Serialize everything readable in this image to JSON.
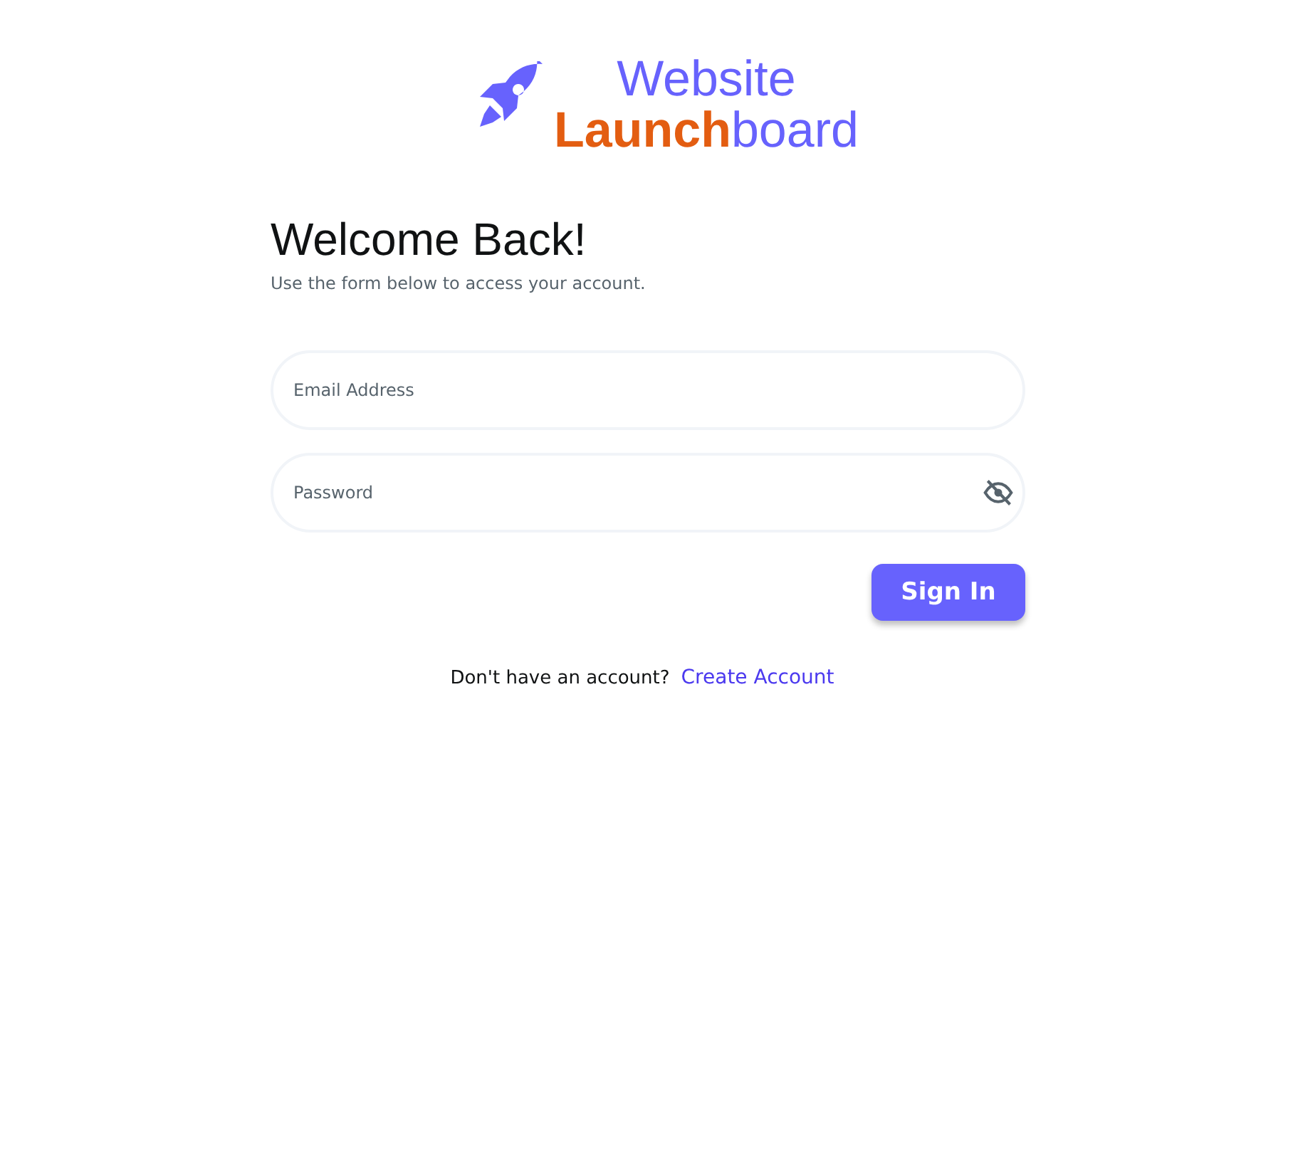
{
  "logo": {
    "line1": "Website",
    "accent": "Launch",
    "rest": "board"
  },
  "title": "Welcome Back!",
  "subtitle": "Use the form below to access your account.",
  "fields": [
    {
      "kind": "text",
      "placeholder": "Email Address"
    },
    {
      "kind": "password",
      "placeholder": "Password"
    }
  ],
  "sign_in": "Sign In",
  "footer": {
    "prompt": "Don't have an account?",
    "link": "Create Account"
  }
}
